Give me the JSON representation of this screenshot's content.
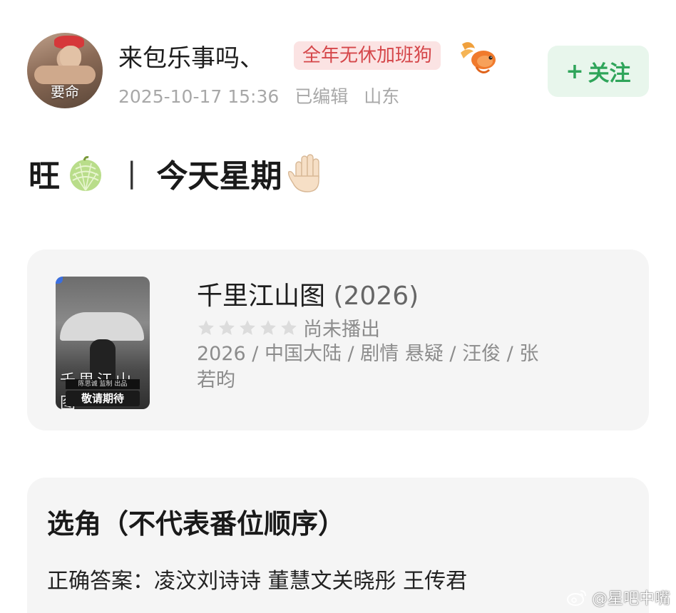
{
  "post": {
    "author": {
      "name": "来包乐事吗、",
      "avatar_caption": "要命",
      "title_tag": "全年无休加班狗",
      "tag_icon": "goldfish-icon"
    },
    "meta": {
      "timestamp": "2025-10-17 15:36",
      "edited": "已编辑",
      "location": "山东"
    },
    "follow_button": {
      "plus": "+",
      "label": "关注"
    },
    "headline": {
      "prefix": "旺",
      "separator": "|",
      "text": "今天星期",
      "icons": [
        "melon-icon",
        "raised-hand-icon"
      ]
    }
  },
  "movie": {
    "title": "千里江山图",
    "year": "(2026)",
    "rating_status": "尚未播出",
    "stars_filled": 0,
    "stars_total": 5,
    "info": "2026 / 中国大陆 / 剧情 悬疑 / 汪俊 / 张若昀",
    "poster": {
      "calligraphy": "千里江山图",
      "banner_small": "陈思诚 监制 出品",
      "banner": "敬请期待"
    }
  },
  "casting": {
    "heading": "选角（不代表番位顺序）",
    "answer": "正确答案：凌汶刘诗诗 董慧文关晓彤 王传君"
  },
  "watermark": {
    "text": "@星吧中嘴"
  },
  "colors": {
    "follow_green": "#2fa55a",
    "follow_bg": "#e8f6ec",
    "tag_red": "#d5474a",
    "tag_bg": "#fbe3e3",
    "meta_gray": "#a8a8a8",
    "card_bg": "#f5f5f5"
  }
}
